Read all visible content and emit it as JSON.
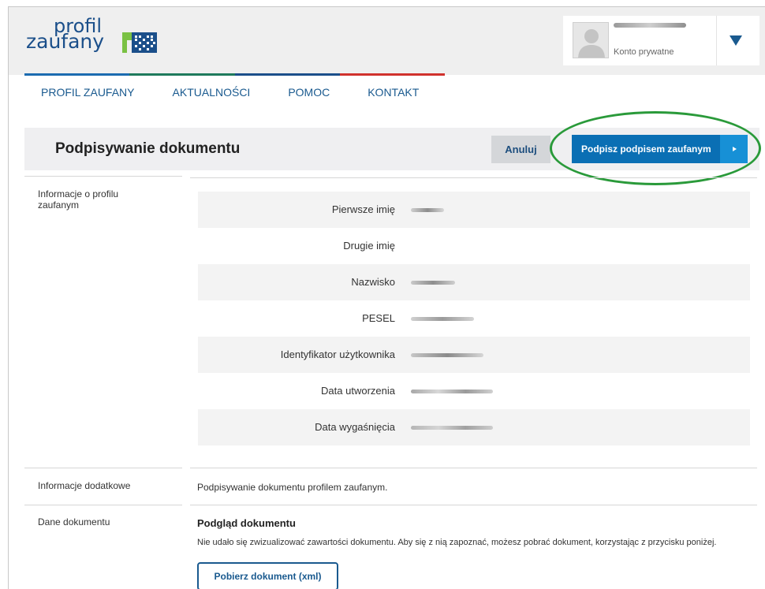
{
  "header": {
    "logo_line1": "profil",
    "logo_line2": "zaufany",
    "account_type": "Konto prywatne"
  },
  "nav": {
    "items": [
      "PROFIL ZAUFANY",
      "AKTUALNOŚCI",
      "POMOC",
      "KONTAKT"
    ],
    "bar_colors": [
      "#1b6bb0",
      "#1f7a5c",
      "#1b4f8a",
      "#d0312d"
    ]
  },
  "titlebar": {
    "title": "Podpisywanie dokumentu",
    "cancel_label": "Anuluj",
    "sign_label": "Podpisz podpisem zaufanym",
    "highlight_color": "#2a9a3a"
  },
  "profile_section": {
    "label": "Informacje o profilu zaufanym",
    "fields": [
      {
        "label": "Pierwsze imię"
      },
      {
        "label": "Drugie imię"
      },
      {
        "label": "Nazwisko"
      },
      {
        "label": "PESEL"
      },
      {
        "label": "Identyfikator użytkownika"
      },
      {
        "label": "Data utworzenia"
      },
      {
        "label": "Data wygaśnięcia"
      }
    ]
  },
  "additional_section": {
    "label": "Informacje dodatkowe",
    "text": "Podpisywanie dokumentu profilem zaufanym."
  },
  "document_section": {
    "label": "Dane dokumentu",
    "preview_title": "Podgląd dokumentu",
    "preview_message": "Nie udało się zwizualizować zawartości dokumentu. Aby się z nią zapoznać, możesz pobrać dokument, korzystając z przycisku poniżej.",
    "download_label": "Pobierz dokument (xml)"
  },
  "colors": {
    "primary": "#0a6fb4",
    "link": "#1a5a8f"
  }
}
